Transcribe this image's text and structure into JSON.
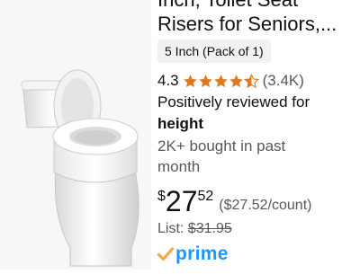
{
  "product": {
    "title_line1": "Inch, Toilet Seat",
    "title_line2": "Risers for Seniors,...",
    "variant": "5 Inch (Pack of 1)",
    "rating": "4.3",
    "rating_stars": 4.3,
    "review_count": "(3.4K)",
    "reviewed_prefix": "Positively reviewed for",
    "reviewed_feature": "height",
    "bought_line1": "2K+ bought in past",
    "bought_line2": "month",
    "price_currency": "$",
    "price_whole": "27",
    "price_fraction": "52",
    "unit_price": "($27.52/count)",
    "list_label": "List:",
    "list_price": "$31.95",
    "prime_label": "prime"
  },
  "colors": {
    "star": "#de7921",
    "prime_blue": "#1a98ff",
    "prime_check": "#f3a847",
    "muted": "#565959"
  }
}
